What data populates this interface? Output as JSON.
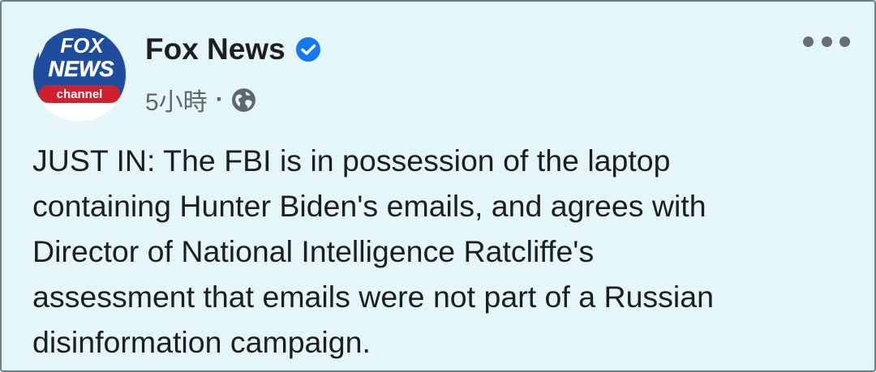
{
  "post": {
    "page_name": "Fox News",
    "verified_icon": "verified-badge-icon",
    "timestamp": "5小時",
    "separator": "·",
    "audience_icon": "globe-icon",
    "more_icon": "more-options-icon",
    "avatar": {
      "logo_line1": "FOX",
      "logo_line2": "NEWS",
      "logo_line3": "channel"
    },
    "text_lines": [
      "JUST IN: The FBI is in possession of the laptop",
      "containing Hunter Biden's emails, and agrees with",
      "Director of National Intelligence Ratcliffe's",
      "assessment that emails were not part of a Russian",
      "disinformation campaign."
    ]
  },
  "colors": {
    "background": "#e4f6f8",
    "text": "#1c1e21",
    "secondary_text": "#5f676c",
    "verified_blue": "#1877f2",
    "fox_blue": "#1d4d9c",
    "fox_red": "#d0202e"
  }
}
